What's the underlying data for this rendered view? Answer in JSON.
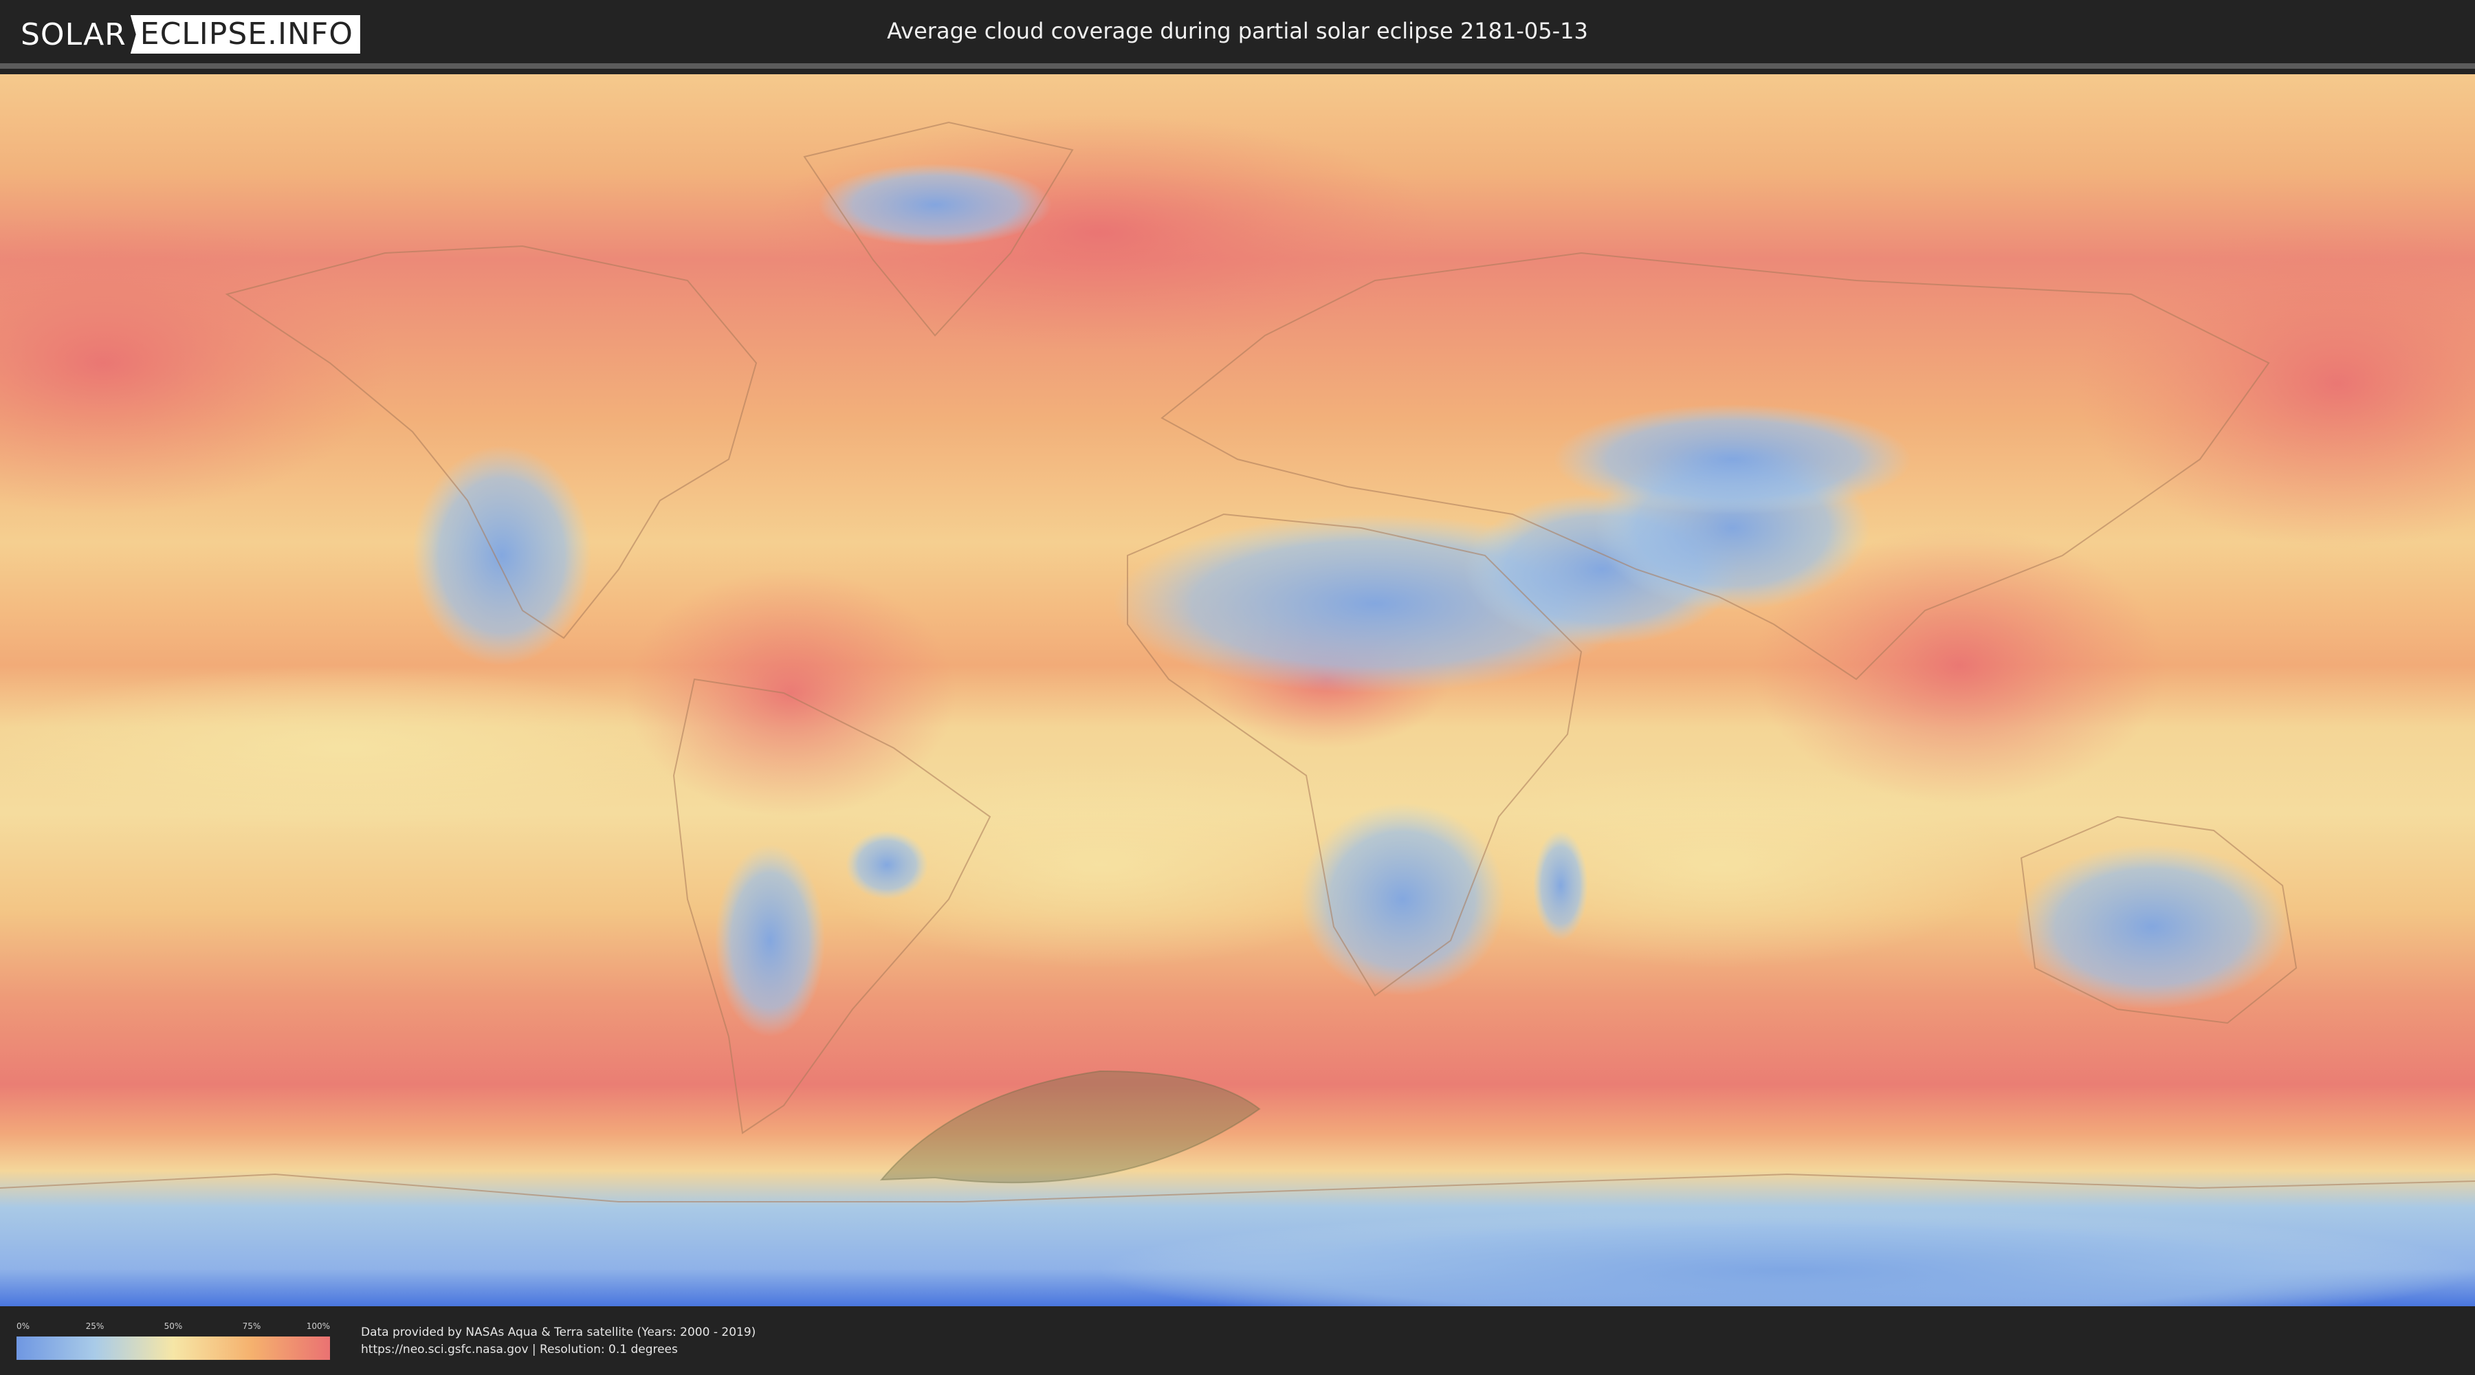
{
  "header": {
    "logo_left": "SOLAR",
    "logo_right": "ECLIPSE.INFO",
    "title": "Average cloud coverage during partial solar eclipse 2181-05-13"
  },
  "map": {
    "projection": "equirectangular",
    "theme": "average-cloud-coverage",
    "eclipse_visibility_region": {
      "description_color": "#6e6e46",
      "lat_range": [
        -60,
        -43
      ],
      "lon_range": [
        -52,
        3
      ]
    }
  },
  "legend": {
    "ticks": [
      "0%",
      "25%",
      "50%",
      "75%",
      "100%"
    ],
    "colors": {
      "c0": "#6f97e2",
      "c25": "#a9cbe8",
      "c50": "#f6e6a6",
      "c75": "#f5b16e",
      "c100": "#ea7272"
    }
  },
  "credits": {
    "line1": "Data provided by NASAs Aqua & Terra satellite (Years: 2000 - 2019)",
    "line2": "https://neo.sci.gsfc.nasa.gov | Resolution: 0.1 degrees"
  }
}
